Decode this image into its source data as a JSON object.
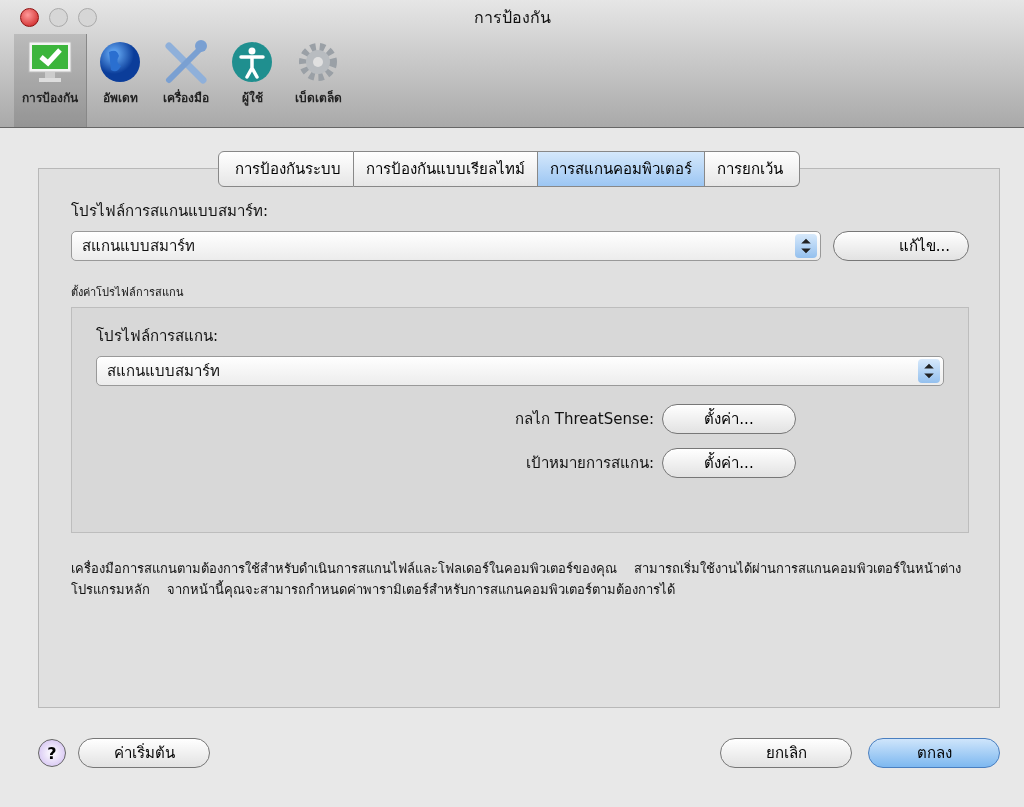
{
  "window": {
    "title": "การป้องกัน"
  },
  "toolbar": [
    {
      "label": "การป้องกัน",
      "kind": "monitor",
      "selected": true
    },
    {
      "label": "อัพเดท",
      "kind": "globe",
      "selected": false
    },
    {
      "label": "เครื่องมือ",
      "kind": "tools",
      "selected": false
    },
    {
      "label": "ผู้ใช้",
      "kind": "person",
      "selected": false
    },
    {
      "label": "เบ็ดเตล็ด",
      "kind": "gear",
      "selected": false
    }
  ],
  "tabs": [
    {
      "label": "การป้องกันระบบ",
      "selected": false
    },
    {
      "label": "การป้องกันแบบเรียลไทม์",
      "selected": false
    },
    {
      "label": "การสแกนคอมพิวเตอร์",
      "selected": true
    },
    {
      "label": "การยกเว้น",
      "selected": false
    }
  ],
  "smart_profile": {
    "label": "โปรไฟล์การสแกนแบบสมาร์ท:",
    "value": "สแกนแบบสมาร์ท",
    "edit_button": "แก้ไข..."
  },
  "profile_settings": {
    "title": "ตั้งค่าโปรไฟล์การสแกน",
    "label": "โปรไฟล์การสแกน:",
    "value": "สแกนแบบสมาร์ท",
    "rows": [
      {
        "label": "กลไก ThreatSense:",
        "button": "ตั้งค่า..."
      },
      {
        "label": "เป้าหมายการสแกน:",
        "button": "ตั้งค่า..."
      }
    ]
  },
  "description": "เครื่องมือการสแกนตามต้องการใช้สำหรับดำเนินการสแกนไฟล์และโฟลเดอร์ในคอมพิวเตอร์ของคุณ    สามารถเริ่มใช้งานได้ผ่านการสแกนคอมพิวเตอร์ในหน้าต่างโปรแกรมหลัก    จากหน้านี้คุณจะสามารถกำหนดค่าพารามิเตอร์สำหรับการสแกนคอมพิวเตอร์ตามต้องการได้",
  "footer": {
    "help": "?",
    "default_button": "ค่าเริ่มต้น",
    "cancel_button": "ยกเลิก",
    "ok_button": "ตกลง"
  }
}
